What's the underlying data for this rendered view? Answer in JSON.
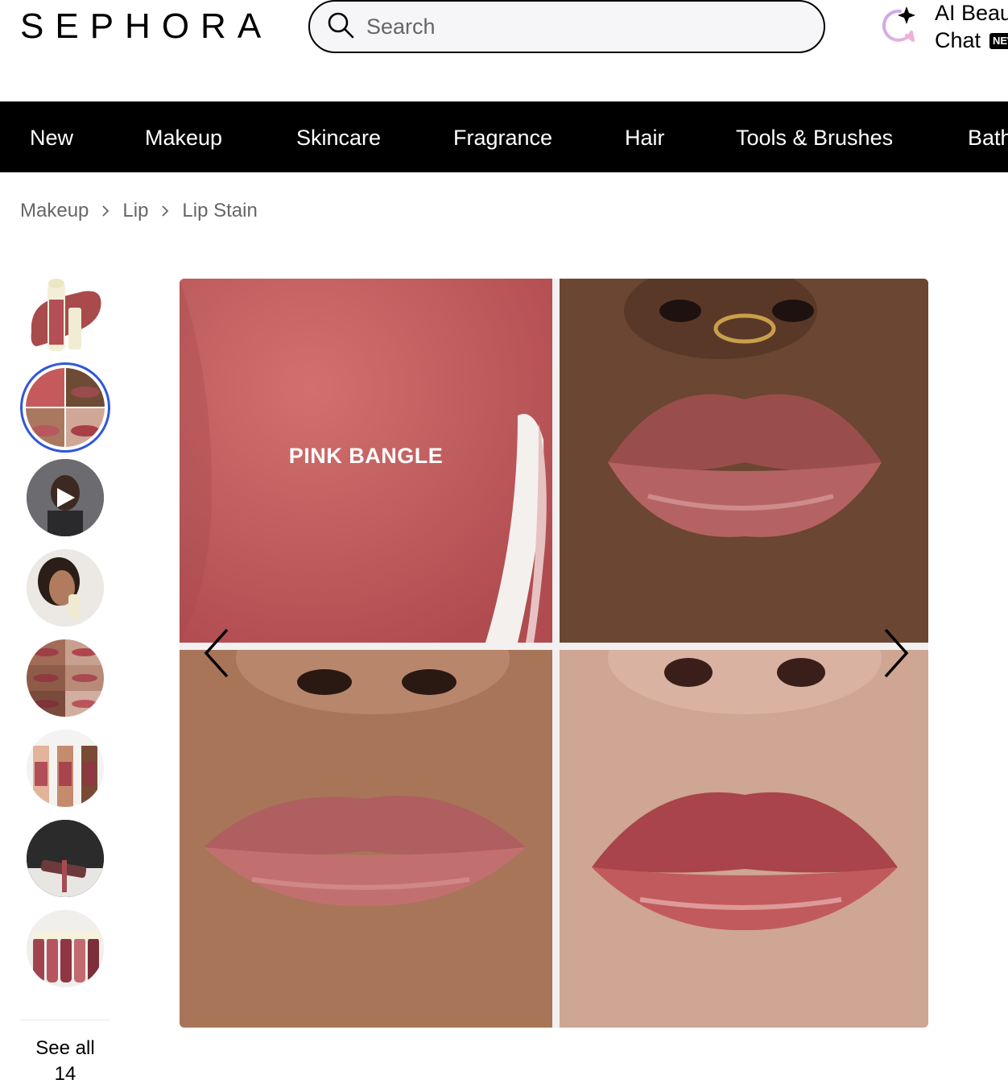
{
  "header": {
    "logo": "SEPHORA",
    "search": {
      "placeholder": "Search",
      "value": ""
    },
    "ai_chat": {
      "line1": "AI Beauty",
      "line2": "Chat",
      "badge": "NEW"
    }
  },
  "nav": {
    "items": [
      "New",
      "Makeup",
      "Skincare",
      "Fragrance",
      "Hair",
      "Tools & Brushes",
      "Bath & Body"
    ]
  },
  "breadcrumb": [
    "Makeup",
    "Lip",
    "Lip Stain"
  ],
  "gallery": {
    "thumbnails": [
      {
        "name": "product-shot",
        "active": false,
        "video": false
      },
      {
        "name": "swatch-grid",
        "active": true,
        "video": false
      },
      {
        "name": "model-video",
        "active": false,
        "video": true
      },
      {
        "name": "model-portrait",
        "active": false,
        "video": false
      },
      {
        "name": "shade-comparison",
        "active": false,
        "video": false
      },
      {
        "name": "arm-swatches",
        "active": false,
        "video": false
      },
      {
        "name": "how-to-wear",
        "active": false,
        "video": false
      },
      {
        "name": "shade-lineup",
        "active": false,
        "video": false
      }
    ],
    "see_all_label": "See all",
    "see_all_count": "14",
    "main_image": {
      "shade_label": "PINK BANGLE"
    }
  },
  "colors": {
    "nav_bg": "#000000",
    "active_thumb_border": "#3158d6",
    "swatch_pink": "#c55a5c"
  },
  "icons": {
    "search": "search-icon",
    "ai": "ai-sparkle-chat-icon",
    "breadcrumb_separator": "chevron-right-icon",
    "prev": "chevron-left-icon",
    "next": "chevron-right-icon",
    "play": "play-icon"
  }
}
